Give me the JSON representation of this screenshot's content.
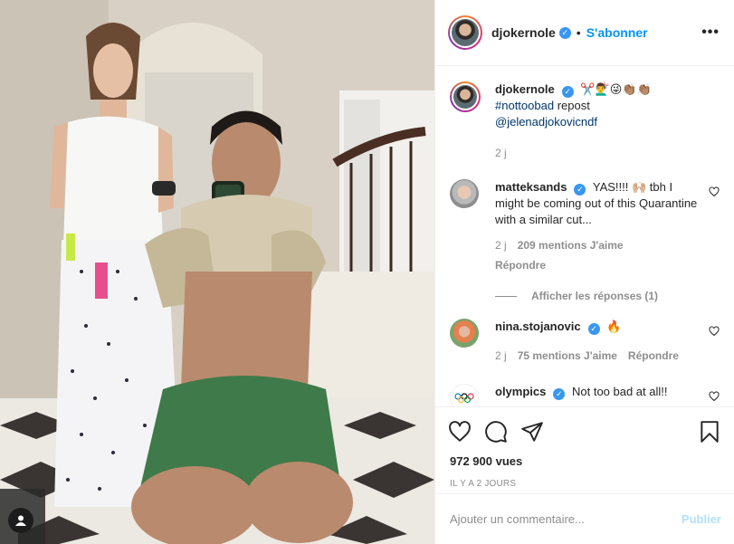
{
  "post": {
    "author": "djokernole",
    "follow_label": "S'abonner",
    "more_label": "•••"
  },
  "caption": {
    "author": "djokernole",
    "emoji": "✂️💇‍♂️😜👏🏽👏🏽",
    "hashtag": "#nottoobad",
    "text": "repost",
    "mention": "@jelenadjokovicndf",
    "time": "2 j"
  },
  "comments": [
    {
      "author": "matteksands",
      "text": "YAS!!!! 🙌🏼 tbh I might be coming out of this Quarantine with a similar cut...",
      "time": "2 j",
      "likes": "209 mentions J'aime",
      "reply": "Répondre",
      "view_replies": "Afficher les réponses (1)"
    },
    {
      "author": "nina.stojanovic",
      "text": "🔥",
      "time": "2 j",
      "likes": "75 mentions J'aime",
      "reply": "Répondre"
    },
    {
      "author": "olympics",
      "text": "Not too bad at all!!"
    }
  ],
  "stats": {
    "views": "972 900 vues",
    "time_ago": "IL Y A 2 JOURS"
  },
  "add_comment": {
    "placeholder": "Ajouter un commentaire...",
    "publish": "Publier"
  },
  "colors": {
    "accent": "#0095f6",
    "verified": "#3897f0",
    "publish_disabled": "#b2dffc",
    "muted": "#8e8e8e"
  },
  "icons": [
    "user-tag-icon",
    "like-icon",
    "comment-icon",
    "share-icon",
    "save-icon",
    "heart-small-icon",
    "verified-icon",
    "more-options-icon"
  ]
}
